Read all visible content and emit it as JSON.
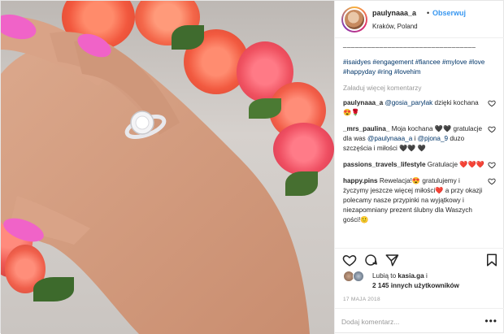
{
  "post": {
    "username": "paulynaaa_a",
    "follow_label": "Obserwuj",
    "location": "Kraków, Poland",
    "separator": "•",
    "caption_dashes": "_________________________________",
    "caption_tags": "#isaidyes #engagement #fiancee #mylove #love #happyday #ring #lovehim",
    "load_more": "Załaduj więcej komentarzy"
  },
  "comments": [
    {
      "author": "paulynaaa_a",
      "mention": "@gosia_parylak",
      "text_after": " dzięki kochana 😍🌹"
    },
    {
      "author": "_mrs_paulina_",
      "text_a": " Moja kochana 🖤🖤 gratulacje dla was ",
      "mention1": "@paulynaaa_a",
      "text_b": " i ",
      "mention2": "@pjona_9",
      "text_c": " duzo szczęścia i miłości 🖤🖤 🖤"
    },
    {
      "author": "passions_travels_lifestyle",
      "text": " Gratulacje ❤️❤️❤️"
    },
    {
      "author": "happy.pins",
      "text": " Rewelacja!😍 gratulujemy i życzymy jeszcze więcej miłości❤️ a przy okazji polecamy nasze przypinki na wyjątkowy i niezapomniany prezent ślubny dla Waszych gości!🙂"
    }
  ],
  "likes": {
    "prefix": "Lubią to ",
    "liker": "kasia.ga",
    "conj": " i",
    "count": "2 145 innych użytkowników"
  },
  "date": "17 MAJA 2018",
  "add_comment_placeholder": "Dodaj komentarz...",
  "more_label": "•••",
  "icons": {
    "heart": "heart-icon",
    "comment": "comment-icon",
    "share": "share-icon",
    "save": "bookmark-icon"
  },
  "colors": {
    "link": "#3897f0",
    "tag": "#003569",
    "muted": "#999999",
    "text": "#262626"
  }
}
